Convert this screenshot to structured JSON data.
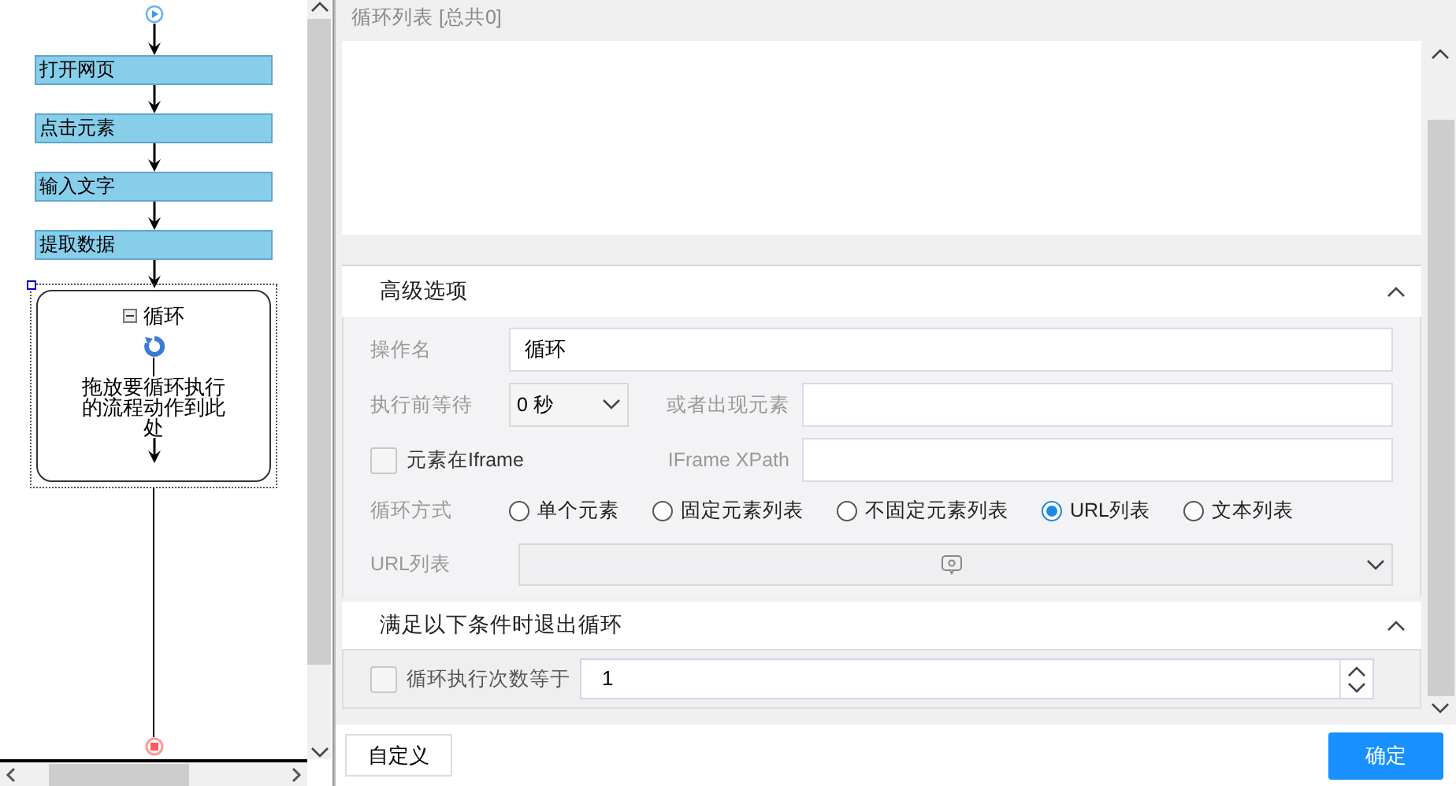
{
  "flow": {
    "steps": [
      {
        "label": "打开网页"
      },
      {
        "label": "点击元素"
      },
      {
        "label": "输入文字"
      },
      {
        "label": "提取数据"
      }
    ],
    "loop": {
      "title": "循环",
      "expanded": true,
      "selected": true,
      "hint": "拖放要循环执行的流程动作到此处"
    }
  },
  "loop_list": {
    "title": "循环列表 [总共0]"
  },
  "advanced": {
    "title": "高级选项",
    "expanded": true,
    "name_label": "操作名",
    "name_value": "循环",
    "wait_label": "执行前等待",
    "wait_value": "0 秒",
    "appear_label": "或者出现元素",
    "iframe": {
      "label": "元素在Iframe",
      "checked": false
    },
    "xpath_label": "IFrame XPath",
    "mode_label": "循环方式",
    "modes": [
      {
        "label": "单个元素",
        "selected": false
      },
      {
        "label": "固定元素列表",
        "selected": false
      },
      {
        "label": "不固定元素列表",
        "selected": false
      },
      {
        "label": "URL列表",
        "selected": true
      },
      {
        "label": "文本列表",
        "selected": false
      }
    ],
    "url_label": "URL列表"
  },
  "exit": {
    "title": "满足以下条件时退出循环",
    "expanded": true,
    "condition": {
      "label": "循环执行次数等于",
      "checked": false,
      "value": "1"
    }
  },
  "buttons": {
    "custom": "自定义",
    "ok": "确定"
  }
}
